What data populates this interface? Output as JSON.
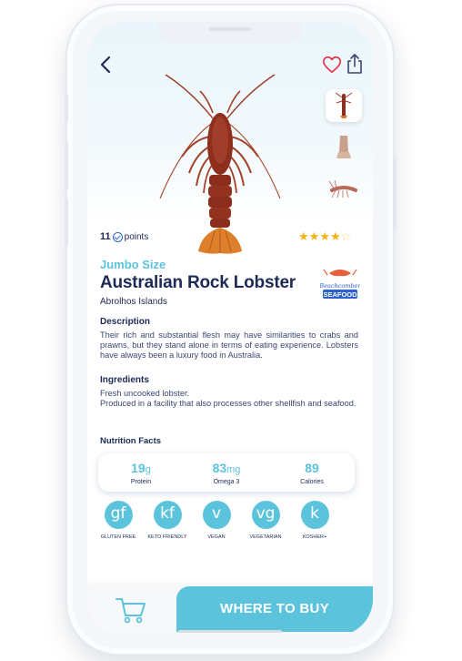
{
  "product": {
    "points_value": "11",
    "points_label": "points",
    "rating": 4,
    "rating_max": 5,
    "size": "Jumbo Size",
    "name": "Australian Rock Lobster",
    "origin": "Abrolhos Islands",
    "brand_logo_text": "Beachcomber SEAFOOD"
  },
  "description": {
    "heading": "Description",
    "text": "Their rich and substantial flesh may have similarities to crabs and prawns, but they stand alone in terms of eating experience. Lobsters have always been a luxury food in Australia."
  },
  "ingredients": {
    "heading": "Ingredients",
    "line1": "Fresh uncooked lobster.",
    "line2": "Produced in a facility that also processes other shellfish and seafood."
  },
  "nutrition": {
    "heading": "Nutrition Facts",
    "items": [
      {
        "value": "19",
        "unit": "g",
        "label": "Protein"
      },
      {
        "value": "83",
        "unit": "mg",
        "label": "Omega 3"
      },
      {
        "value": "89",
        "unit": "",
        "label": "Calories"
      }
    ]
  },
  "diets": [
    {
      "abbr": "gf",
      "label": "GLUTEN FREE"
    },
    {
      "abbr": "kf",
      "label": "KETO FRIENDLY"
    },
    {
      "abbr": "v",
      "label": "VEGAN"
    },
    {
      "abbr": "vg",
      "label": "VEGETARIAN"
    },
    {
      "abbr": "k",
      "label": "KOSHER+"
    }
  ],
  "actions": {
    "buy_label": "WHERE TO BUY"
  },
  "colors": {
    "accent": "#5cc3dd",
    "text_dark": "#1d2a55",
    "star": "#f2b21a",
    "heart": "#e2324a"
  },
  "icons": [
    "back-chevron-icon",
    "heart-icon",
    "share-icon",
    "check-badge-icon",
    "star-icon",
    "cart-icon"
  ]
}
